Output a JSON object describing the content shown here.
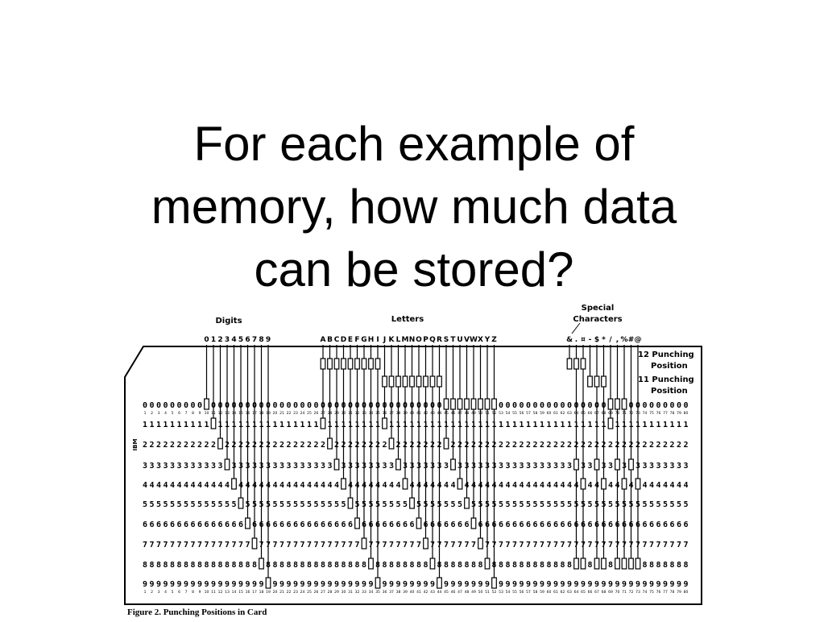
{
  "slide": {
    "title_lines": [
      "For each example of",
      "memory, how much data",
      "can be stored?"
    ]
  },
  "figure": {
    "headings": {
      "digits": "Digits",
      "letters": "Letters",
      "special": [
        "Special",
        "Characters"
      ]
    },
    "character_groups": {
      "digits": "0123456789",
      "letters": "ABCDEFGHIJKLMNOPQRSTUVWXYZ",
      "special": "&.¤-$*/,%#@"
    },
    "zone_labels": {
      "twelve": [
        "12 Punching",
        "Position"
      ],
      "eleven": [
        "11 Punching",
        "Position"
      ]
    },
    "side_mark": "IBM",
    "row_digits": [
      "0",
      "1",
      "2",
      "3",
      "4",
      "5",
      "6",
      "7",
      "8",
      "9"
    ],
    "column_count": 80,
    "caption": "Figure 2.  Punching Positions in Card"
  },
  "colors": {
    "ink": "#000000",
    "paper": "#ffffff"
  }
}
